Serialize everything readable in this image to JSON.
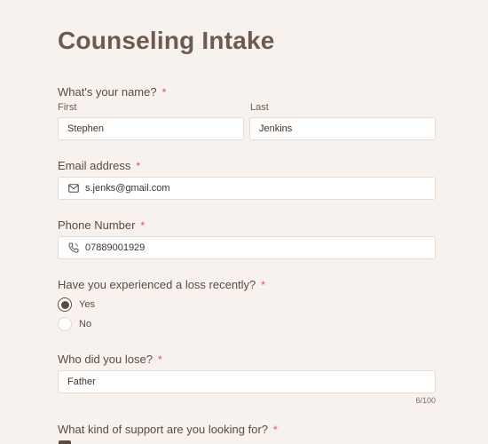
{
  "form": {
    "title": "Counseling Intake",
    "required_mark": "*",
    "name": {
      "label": "What's your name?",
      "first_label": "First",
      "first_value": "Stephen",
      "last_label": "Last",
      "last_value": "Jenkins"
    },
    "email": {
      "label": "Email address",
      "value": "s.jenks@gmail.com",
      "icon": "mail-icon"
    },
    "phone": {
      "label": "Phone Number",
      "value": "07889001929",
      "icon": "phone-icon"
    },
    "loss": {
      "label": "Have you experienced a loss recently?",
      "options": [
        {
          "label": "Yes",
          "selected": true
        },
        {
          "label": "No",
          "selected": false
        }
      ]
    },
    "who": {
      "label": "Who did you lose?",
      "value": "Father",
      "counter": "6/100"
    },
    "support": {
      "label": "What kind of support are you looking for?"
    }
  },
  "colors": {
    "background": "#f8f2ef",
    "text": "#5b4a42",
    "required": "#e0457b",
    "input_bg": "#ffffff",
    "input_border": "#e6dcd6"
  }
}
